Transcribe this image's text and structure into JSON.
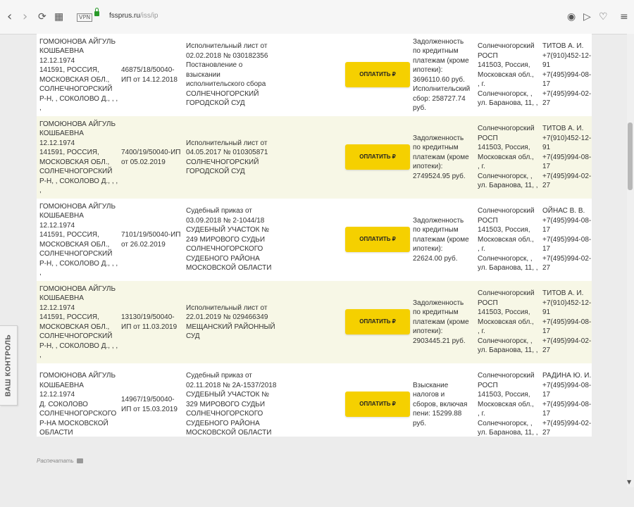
{
  "browser": {
    "back_icon": "‹",
    "forward_icon": "›",
    "reload_icon": "⟳",
    "tabs_icon": "▦",
    "vpn_badge": "VPN",
    "url_host": "fssprus.ru",
    "url_path": "/iss/ip",
    "camera_icon": "◉",
    "send_icon": "▷",
    "heart_icon": "♡",
    "settings_icon": "≡"
  },
  "rows": [
    {
      "name_lines": [
        "ГОМОЮНОВА АЙГУЛЬ",
        "КОШБАЕВНА",
        "12.12.1974",
        "141591, РОССИЯ,",
        "МОСКОВСКАЯ ОБЛ.,",
        "СОЛНЕЧНОГОРСКИЙ",
        "Р-Н, , СОКОЛОВО Д., , ,",
        ","
      ],
      "ip_lines": [
        "46875/18/50040-",
        "ИП от 14.12.2018"
      ],
      "doc_lines": [
        "Исполнительный лист от",
        "02.02.2018 № 030182356",
        "Постановление о",
        "взыскании",
        "исполнительского сбора",
        "СОЛНЕЧНОГОРСКИЙ",
        "ГОРОДСКОЙ СУД"
      ],
      "pay_label": "ОПЛАТИТЬ ₽",
      "subject_lines": [
        "Задолженность",
        "по кредитным",
        "платежам (кроме",
        "ипотеки):",
        "3696110.60 руб.",
        "Исполнительский",
        "сбор: 258727.74",
        "руб."
      ],
      "dept_lines": [
        "Солнечногорский",
        "РОСП",
        "141503, Россия,",
        "Московская обл.,",
        ", г.",
        "Солнечногорск, ,",
        "ул. Баранова, 11, ,"
      ],
      "officer_lines": [
        "ТИТОВ А. И.",
        "+7(910)452-12-",
        "91",
        "+7(495)994-08-",
        "17",
        "+7(495)994-02-",
        "27"
      ]
    },
    {
      "name_lines": [
        "ГОМОЮНОВА АЙГУЛЬ",
        "КОШБАЕВНА",
        "12.12.1974",
        "141591, РОССИЯ,",
        "МОСКОВСКАЯ ОБЛ.,",
        "СОЛНЕЧНОГОРСКИЙ",
        "Р-Н, , СОКОЛОВО Д., , ,",
        ","
      ],
      "ip_lines": [
        "7400/19/50040-ИП",
        "от 05.02.2019"
      ],
      "doc_lines": [
        "Исполнительный лист от",
        "04.05.2017 № 010305871",
        "СОЛНЕЧНОГОРСКИЙ",
        "ГОРОДСКОЙ СУД"
      ],
      "pay_label": "ОПЛАТИТЬ ₽",
      "subject_lines": [
        "Задолженность",
        "по кредитным",
        "платежам (кроме",
        "ипотеки):",
        "2749524.95 руб."
      ],
      "dept_lines": [
        "Солнечногорский",
        "РОСП",
        "141503, Россия,",
        "Московская обл.,",
        ", г.",
        "Солнечногорск, ,",
        "ул. Баранова, 11, ,"
      ],
      "officer_lines": [
        "ТИТОВ А. И.",
        "+7(910)452-12-",
        "91",
        "+7(495)994-08-",
        "17",
        "+7(495)994-02-",
        "27"
      ]
    },
    {
      "name_lines": [
        "ГОМОЮНОВА АЙГУЛЬ",
        "КОШБАЕВНА",
        "12.12.1974",
        "141591, РОССИЯ,",
        "МОСКОВСКАЯ ОБЛ.,",
        "СОЛНЕЧНОГОРСКИЙ",
        "Р-Н, , СОКОЛОВО Д., , ,",
        ","
      ],
      "ip_lines": [
        "7101/19/50040-ИП",
        "от 26.02.2019"
      ],
      "doc_lines": [
        "Судебный приказ от",
        "03.09.2018 № 2-1044/18",
        "СУДЕБНЫЙ УЧАСТОК №",
        "249 МИРОВОГО СУДЬИ",
        "СОЛНЕЧНОГОРСКОГО",
        "СУДЕБНОГО РАЙОНА",
        "МОСКОВСКОЙ ОБЛАСТИ"
      ],
      "pay_label": "ОПЛАТИТЬ ₽",
      "subject_lines": [
        "Задолженность",
        "по кредитным",
        "платежам (кроме",
        "ипотеки):",
        "22624.00 руб."
      ],
      "dept_lines": [
        "Солнечногорский",
        "РОСП",
        "141503, Россия,",
        "Московская обл.,",
        ", г.",
        "Солнечногорск, ,",
        "ул. Баранова, 11, ,"
      ],
      "officer_lines": [
        "ОЙНАС В. В.",
        "+7(495)994-08-",
        "17",
        "+7(495)994-08-",
        "17",
        "+7(495)994-02-",
        "27"
      ]
    },
    {
      "name_lines": [
        "ГОМОЮНОВА АЙГУЛЬ",
        "КОШБАЕВНА",
        "12.12.1974",
        "141591, РОССИЯ,",
        "МОСКОВСКАЯ ОБЛ.,",
        "СОЛНЕЧНОГОРСКИЙ",
        "Р-Н, , СОКОЛОВО Д., , ,",
        ","
      ],
      "ip_lines": [
        "13130/19/50040-",
        "ИП от 11.03.2019"
      ],
      "doc_lines": [
        "Исполнительный лист от",
        "22.01.2019 № 029466349",
        "МЕЩАНСКИЙ РАЙОННЫЙ",
        "СУД"
      ],
      "pay_label": "ОПЛАТИТЬ ₽",
      "subject_lines": [
        "Задолженность",
        "по кредитным",
        "платежам (кроме",
        "ипотеки):",
        "2903445.21 руб."
      ],
      "dept_lines": [
        "Солнечногорский",
        "РОСП",
        "141503, Россия,",
        "Московская обл.,",
        ", г.",
        "Солнечногорск, ,",
        "ул. Баранова, 11, ,"
      ],
      "officer_lines": [
        "ТИТОВ А. И.",
        "+7(910)452-12-",
        "91",
        "+7(495)994-08-",
        "17",
        "+7(495)994-02-",
        "27"
      ]
    },
    {
      "name_lines": [
        "ГОМОЮНОВА АЙГУЛЬ",
        "КОШБАЕВНА",
        "12.12.1974",
        "Д. СОКОЛОВО",
        "СОЛНЕЧНОГОРСКОГО",
        "Р-НА МОСКОВСКОЙ",
        "ОБЛАСТИ"
      ],
      "ip_lines": [
        "14967/19/50040-",
        "ИП от 15.03.2019"
      ],
      "doc_lines": [
        "Судебный приказ от",
        "02.11.2018 № 2А-1537/2018",
        "СУДЕБНЫЙ УЧАСТОК №",
        "329 МИРОВОГО СУДЬИ",
        "СОЛНЕЧНОГОРСКОГО",
        "СУДЕБНОГО РАЙОНА",
        "МОСКОВСКОЙ ОБЛАСТИ"
      ],
      "pay_label": "ОПЛАТИТЬ ₽",
      "subject_lines": [
        "Взыскание",
        "налогов и",
        "сборов, включая",
        "пени: 15299.88",
        "руб."
      ],
      "dept_lines": [
        "Солнечногорский",
        "РОСП",
        "141503, Россия,",
        "Московская обл.,",
        ", г.",
        "Солнечногорск, ,",
        "ул. Баранова, 11, ,"
      ],
      "officer_lines": [
        "РАДИНА Ю. И.",
        "+7(495)994-08-",
        "17",
        "+7(495)994-08-",
        "17",
        "+7(495)994-02-",
        "27"
      ]
    }
  ],
  "footer": {
    "print_label": "Распечатать"
  },
  "side_tab": {
    "label": "ВАШ КОНТРОЛЬ"
  }
}
